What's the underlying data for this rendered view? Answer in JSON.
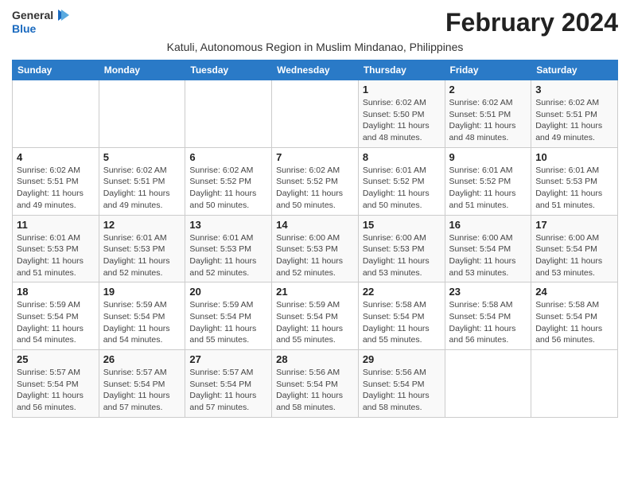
{
  "logo": {
    "text_general": "General",
    "text_blue": "Blue",
    "icon_shape": "triangle"
  },
  "title": {
    "month_year": "February 2024",
    "location": "Katuli, Autonomous Region in Muslim Mindanao, Philippines"
  },
  "weekdays": [
    "Sunday",
    "Monday",
    "Tuesday",
    "Wednesday",
    "Thursday",
    "Friday",
    "Saturday"
  ],
  "weeks": [
    [
      {
        "day": "",
        "info": ""
      },
      {
        "day": "",
        "info": ""
      },
      {
        "day": "",
        "info": ""
      },
      {
        "day": "",
        "info": ""
      },
      {
        "day": "1",
        "info": "Sunrise: 6:02 AM\nSunset: 5:50 PM\nDaylight: 11 hours\nand 48 minutes."
      },
      {
        "day": "2",
        "info": "Sunrise: 6:02 AM\nSunset: 5:51 PM\nDaylight: 11 hours\nand 48 minutes."
      },
      {
        "day": "3",
        "info": "Sunrise: 6:02 AM\nSunset: 5:51 PM\nDaylight: 11 hours\nand 49 minutes."
      }
    ],
    [
      {
        "day": "4",
        "info": "Sunrise: 6:02 AM\nSunset: 5:51 PM\nDaylight: 11 hours\nand 49 minutes."
      },
      {
        "day": "5",
        "info": "Sunrise: 6:02 AM\nSunset: 5:51 PM\nDaylight: 11 hours\nand 49 minutes."
      },
      {
        "day": "6",
        "info": "Sunrise: 6:02 AM\nSunset: 5:52 PM\nDaylight: 11 hours\nand 50 minutes."
      },
      {
        "day": "7",
        "info": "Sunrise: 6:02 AM\nSunset: 5:52 PM\nDaylight: 11 hours\nand 50 minutes."
      },
      {
        "day": "8",
        "info": "Sunrise: 6:01 AM\nSunset: 5:52 PM\nDaylight: 11 hours\nand 50 minutes."
      },
      {
        "day": "9",
        "info": "Sunrise: 6:01 AM\nSunset: 5:52 PM\nDaylight: 11 hours\nand 51 minutes."
      },
      {
        "day": "10",
        "info": "Sunrise: 6:01 AM\nSunset: 5:53 PM\nDaylight: 11 hours\nand 51 minutes."
      }
    ],
    [
      {
        "day": "11",
        "info": "Sunrise: 6:01 AM\nSunset: 5:53 PM\nDaylight: 11 hours\nand 51 minutes."
      },
      {
        "day": "12",
        "info": "Sunrise: 6:01 AM\nSunset: 5:53 PM\nDaylight: 11 hours\nand 52 minutes."
      },
      {
        "day": "13",
        "info": "Sunrise: 6:01 AM\nSunset: 5:53 PM\nDaylight: 11 hours\nand 52 minutes."
      },
      {
        "day": "14",
        "info": "Sunrise: 6:00 AM\nSunset: 5:53 PM\nDaylight: 11 hours\nand 52 minutes."
      },
      {
        "day": "15",
        "info": "Sunrise: 6:00 AM\nSunset: 5:53 PM\nDaylight: 11 hours\nand 53 minutes."
      },
      {
        "day": "16",
        "info": "Sunrise: 6:00 AM\nSunset: 5:54 PM\nDaylight: 11 hours\nand 53 minutes."
      },
      {
        "day": "17",
        "info": "Sunrise: 6:00 AM\nSunset: 5:54 PM\nDaylight: 11 hours\nand 53 minutes."
      }
    ],
    [
      {
        "day": "18",
        "info": "Sunrise: 5:59 AM\nSunset: 5:54 PM\nDaylight: 11 hours\nand 54 minutes."
      },
      {
        "day": "19",
        "info": "Sunrise: 5:59 AM\nSunset: 5:54 PM\nDaylight: 11 hours\nand 54 minutes."
      },
      {
        "day": "20",
        "info": "Sunrise: 5:59 AM\nSunset: 5:54 PM\nDaylight: 11 hours\nand 55 minutes."
      },
      {
        "day": "21",
        "info": "Sunrise: 5:59 AM\nSunset: 5:54 PM\nDaylight: 11 hours\nand 55 minutes."
      },
      {
        "day": "22",
        "info": "Sunrise: 5:58 AM\nSunset: 5:54 PM\nDaylight: 11 hours\nand 55 minutes."
      },
      {
        "day": "23",
        "info": "Sunrise: 5:58 AM\nSunset: 5:54 PM\nDaylight: 11 hours\nand 56 minutes."
      },
      {
        "day": "24",
        "info": "Sunrise: 5:58 AM\nSunset: 5:54 PM\nDaylight: 11 hours\nand 56 minutes."
      }
    ],
    [
      {
        "day": "25",
        "info": "Sunrise: 5:57 AM\nSunset: 5:54 PM\nDaylight: 11 hours\nand 56 minutes."
      },
      {
        "day": "26",
        "info": "Sunrise: 5:57 AM\nSunset: 5:54 PM\nDaylight: 11 hours\nand 57 minutes."
      },
      {
        "day": "27",
        "info": "Sunrise: 5:57 AM\nSunset: 5:54 PM\nDaylight: 11 hours\nand 57 minutes."
      },
      {
        "day": "28",
        "info": "Sunrise: 5:56 AM\nSunset: 5:54 PM\nDaylight: 11 hours\nand 58 minutes."
      },
      {
        "day": "29",
        "info": "Sunrise: 5:56 AM\nSunset: 5:54 PM\nDaylight: 11 hours\nand 58 minutes."
      },
      {
        "day": "",
        "info": ""
      },
      {
        "day": "",
        "info": ""
      }
    ]
  ]
}
